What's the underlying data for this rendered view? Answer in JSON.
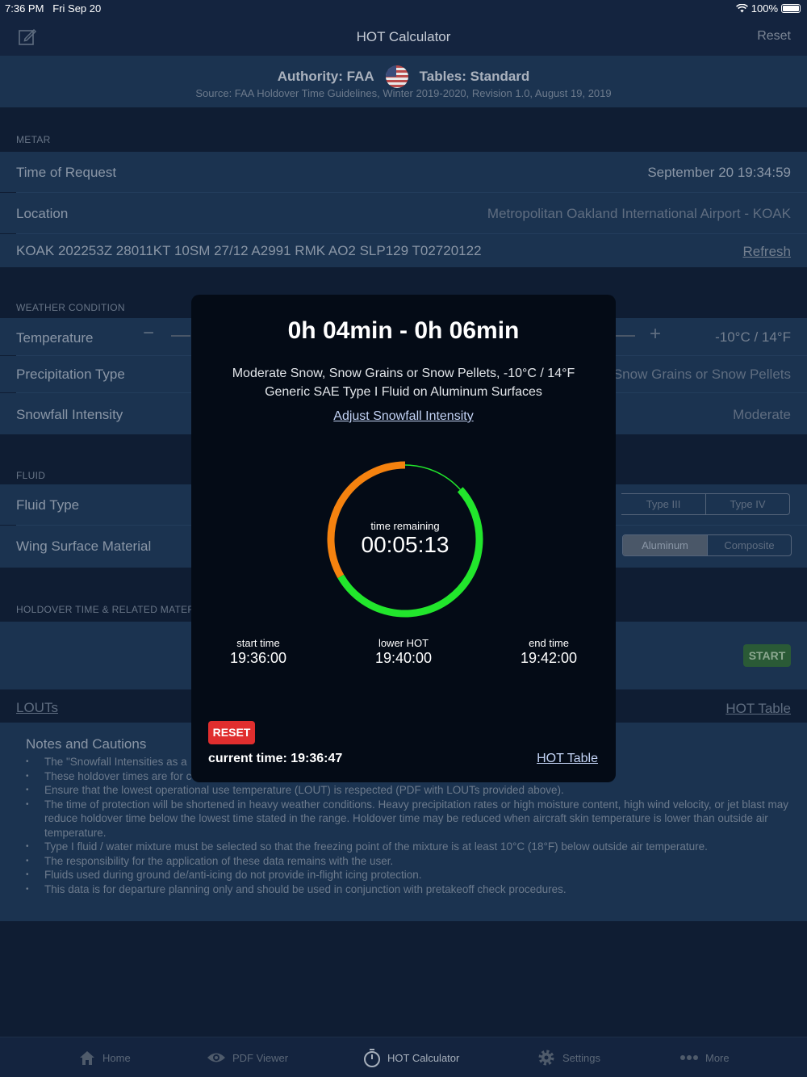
{
  "status_bar": {
    "time": "7:36 PM",
    "date": "Fri Sep 20",
    "battery": "100%"
  },
  "nav": {
    "title": "HOT Calculator",
    "reset": "Reset"
  },
  "authority": {
    "authority": "Authority: FAA",
    "tables": "Tables: Standard",
    "source": "Source: FAA Holdover Time Guidelines, Winter 2019-2020, Revision 1.0, August 19, 2019"
  },
  "metar": {
    "section": "METAR",
    "time_label": "Time of Request",
    "time_value": "September 20 19:34:59",
    "location_label": "Location",
    "location_value": "Metropolitan Oakland International Airport - KOAK",
    "metar_text": "KOAK 202253Z 28011KT 10SM 27/12 A2991 RMK AO2 SLP129 T02720122",
    "refresh": "Refresh"
  },
  "weather": {
    "section": "WEATHER CONDITION",
    "temperature_label": "Temperature",
    "temperature_value": "-10°C / 14°F",
    "precip_label": "Precipitation Type",
    "precip_value": "Snow Grains or Snow Pellets",
    "intensity_label": "Snowfall Intensity",
    "intensity_value": "Moderate"
  },
  "fluid": {
    "section": "FLUID",
    "type_label": "Fluid Type",
    "type_options": [
      "Type III",
      "Type IV"
    ],
    "surface_label": "Wing Surface Material",
    "surface_options": [
      "Aluminum",
      "Composite"
    ],
    "surface_selected": "Aluminum"
  },
  "holdover": {
    "section": "HOLDOVER TIME & RELATED MATER",
    "start": "START",
    "louts": "LOUTs",
    "hot_table": "HOT Table"
  },
  "notes": {
    "title": "Notes and Cautions",
    "items": [
      "The \"Snowfall Intensities as a",
      "These holdover times are for c",
      "Ensure that the lowest operational use temperature (LOUT) is respected (PDF with LOUTs provided above).",
      "The time of protection will be shortened in heavy weather conditions. Heavy precipitation rates or high moisture content, high wind velocity, or jet blast may reduce holdover time below the lowest time stated in the range. Holdover time may be reduced when aircraft skin temperature is lower than outside air temperature.",
      "Type I fluid / water mixture must be selected so that the freezing point of the mixture is at least 10°C (18°F) below outside air temperature.",
      "The responsibility for the application of these data remains with the user.",
      "Fluids used during ground de/anti-icing do not provide in-flight icing protection.",
      "This data is for departure planning only and should be used in conjunction with pretakeoff check procedures."
    ]
  },
  "modal": {
    "range": "0h 04min - 0h 06min",
    "desc_line1": "Moderate Snow, Snow Grains or Snow Pellets, -10°C / 14°F",
    "desc_line2": "Generic SAE Type I Fluid on Aluminum Surfaces",
    "adjust": "Adjust Snowfall Intensity",
    "remaining_label": "time remaining",
    "remaining_value": "00:05:13",
    "elapsed_fraction": 0.133,
    "lower_fraction": 0.667,
    "start_label": "start time",
    "start_value": "19:36:00",
    "lower_label": "lower HOT",
    "lower_value": "19:40:00",
    "end_label": "end time",
    "end_value": "19:42:00",
    "reset": "RESET",
    "current_time": "current time: 19:36:47",
    "hot_table": "HOT Table",
    "colors": {
      "green": "#22e62c",
      "orange": "#f5820f"
    }
  },
  "tabs": [
    {
      "label": "Home",
      "icon": "home-icon"
    },
    {
      "label": "PDF Viewer",
      "icon": "eye-icon"
    },
    {
      "label": "HOT Calculator",
      "icon": "stopwatch-icon"
    },
    {
      "label": "Settings",
      "icon": "gear-icon"
    },
    {
      "label": "More",
      "icon": "more-icon"
    }
  ]
}
